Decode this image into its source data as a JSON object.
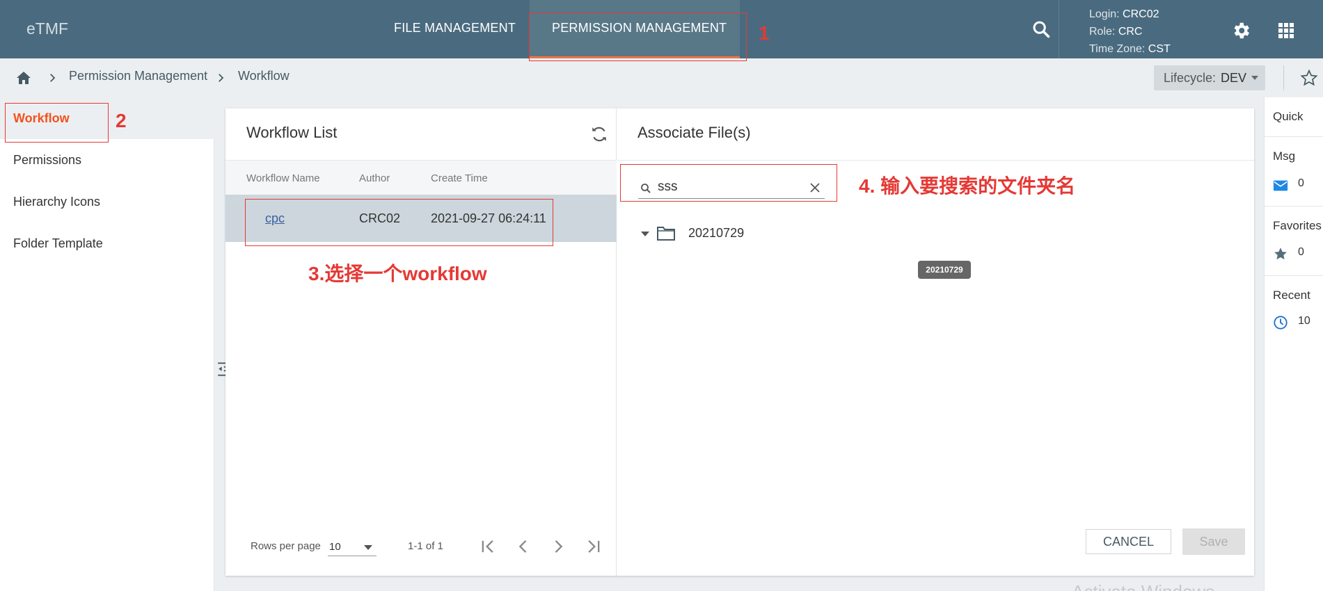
{
  "app": {
    "brand": "eTMF"
  },
  "nav": {
    "tabs": [
      {
        "label": "FILE MANAGEMENT"
      },
      {
        "label": "PERMISSION MANAGEMENT"
      }
    ]
  },
  "user": {
    "login_label": "Login:",
    "login": "CRC02",
    "role_label": "Role:",
    "role": "CRC",
    "tz_label": "Time Zone:",
    "tz": "CST"
  },
  "breadcrumb": {
    "items": [
      "Permission Management",
      "Workflow"
    ]
  },
  "lifecycle": {
    "label": "Lifecycle:",
    "value": "DEV"
  },
  "sidebar": {
    "items": [
      {
        "label": "Workflow"
      },
      {
        "label": "Permissions"
      },
      {
        "label": "Hierarchy Icons"
      },
      {
        "label": "Folder Template"
      }
    ]
  },
  "workflow_list": {
    "title": "Workflow List",
    "columns": [
      "Workflow Name",
      "Author",
      "Create Time"
    ],
    "rows": [
      {
        "name": "cpc",
        "author": "CRC02",
        "create_time": "2021-09-27 06:24:11"
      }
    ],
    "pager": {
      "rows_label": "Rows per page",
      "rows_value": "10",
      "range": "1-1 of 1"
    }
  },
  "associate": {
    "title": "Associate File(s)",
    "search_value": "sss",
    "tree": [
      {
        "name": "20210729"
      }
    ],
    "tooltip": "20210729",
    "cancel_label": "CANCEL",
    "save_label": "Save"
  },
  "quick": {
    "title": "Quick",
    "msg_label": "Msg",
    "msg_count": "0",
    "favorites_label": "Favorites",
    "favorites_count": "0",
    "recent_label": "Recent",
    "recent_count": "10"
  },
  "annotations": {
    "n1": "1",
    "n2": "2",
    "step3": "3.选择一个workflow",
    "step4": "4. 输入要搜索的文件夹名"
  },
  "watermark": "Activate Windows",
  "colors": {
    "header": "#4a6b7f",
    "accent": "#f4511e",
    "annotation": "#e53935"
  }
}
